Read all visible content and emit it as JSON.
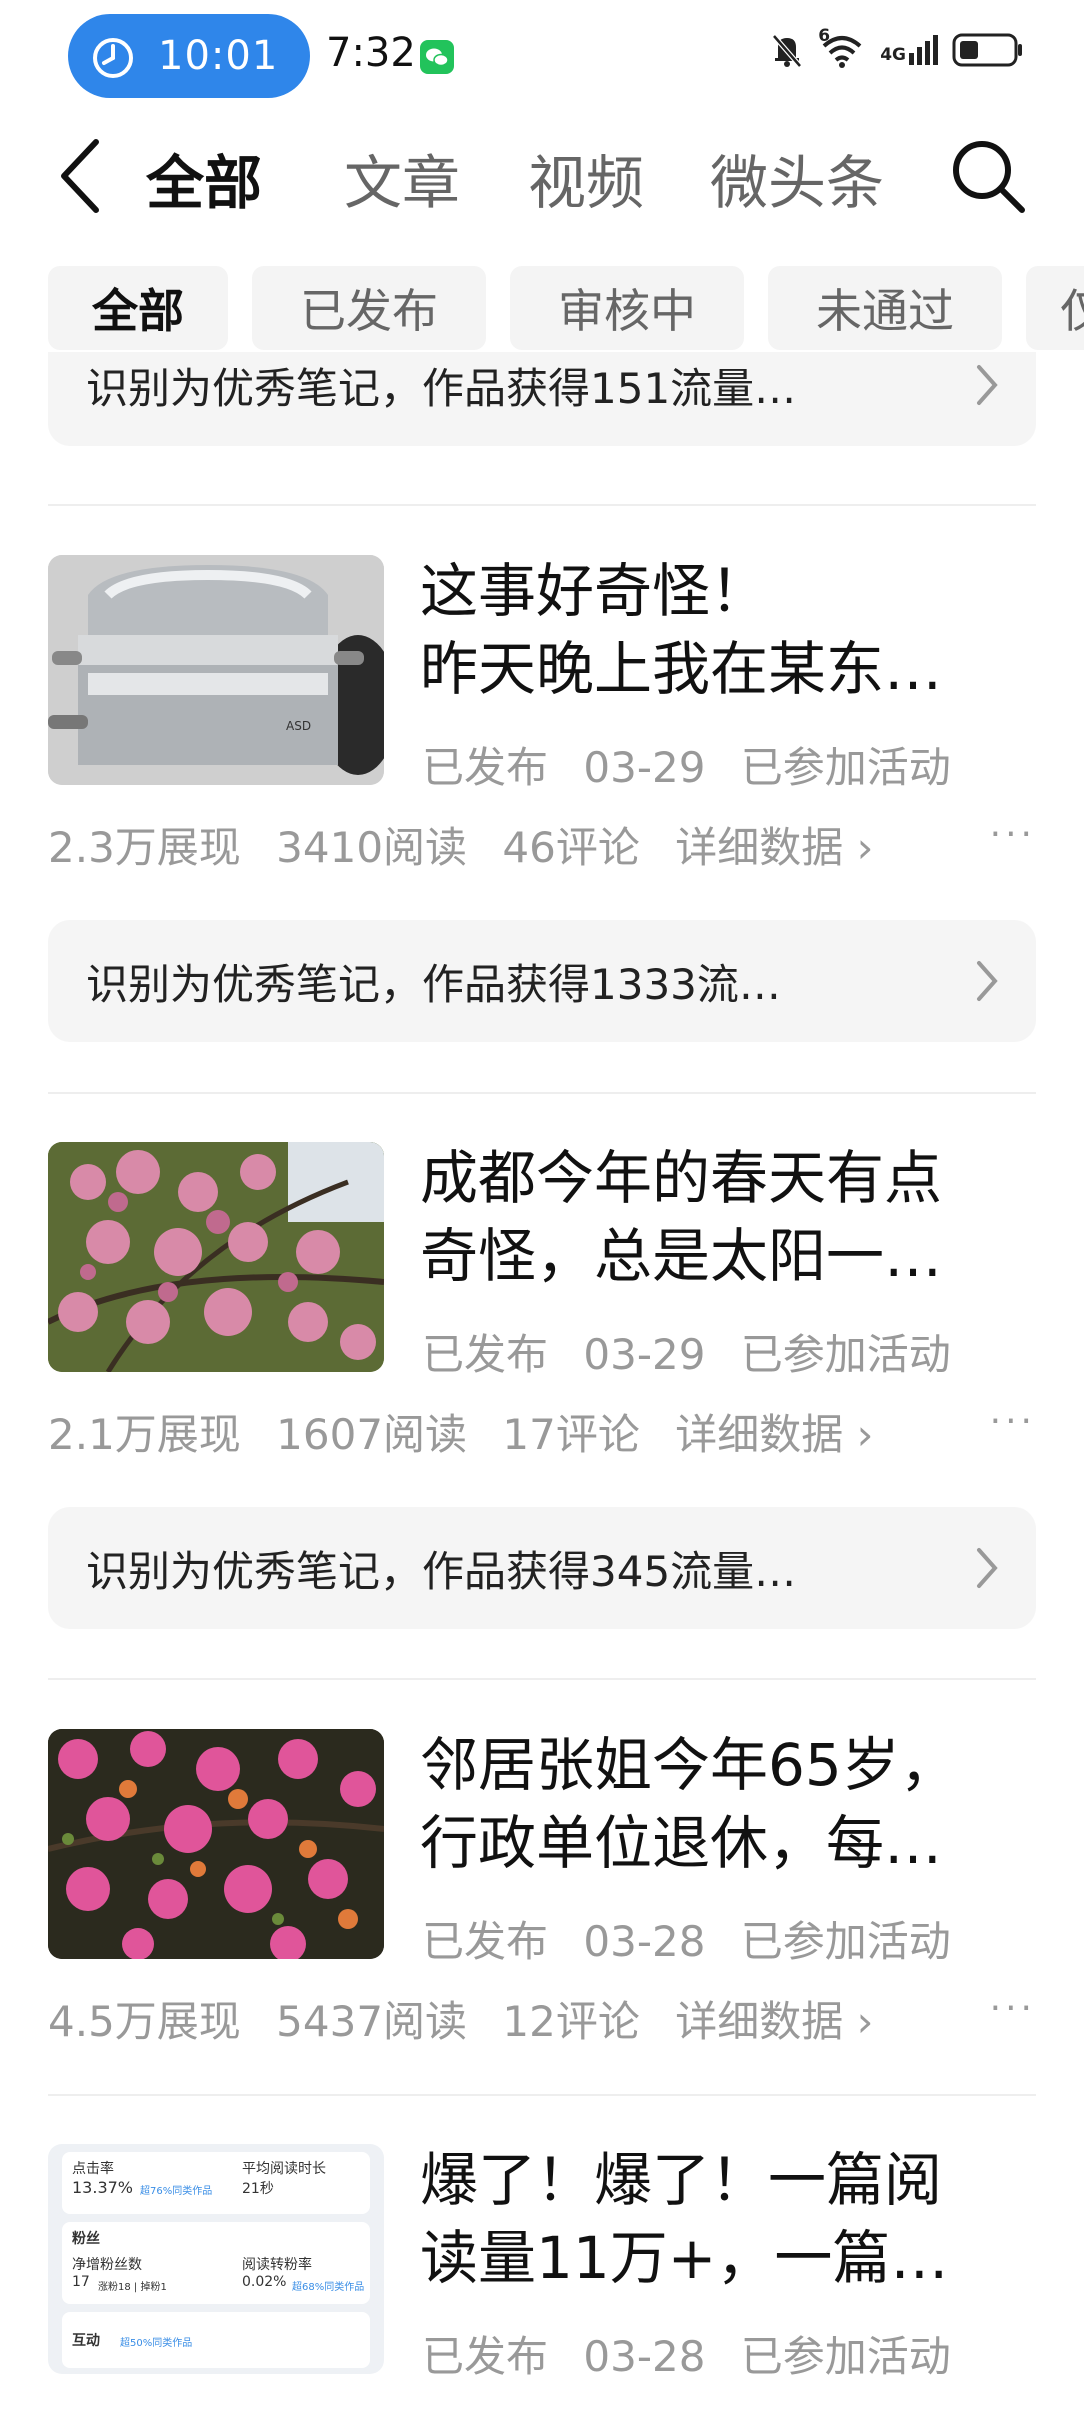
{
  "status_bar": {
    "timer": "10:01",
    "clock": "7:32",
    "signal_label": "6",
    "network": "4G",
    "icons": [
      "timer-icon",
      "wechat-icon",
      "mute-bell-icon",
      "wifi-icon",
      "signal-icon",
      "battery-icon"
    ]
  },
  "nav": {
    "tabs": [
      {
        "label": "全部",
        "active": true
      },
      {
        "label": "文章",
        "active": false
      },
      {
        "label": "视频",
        "active": false
      },
      {
        "label": "微头条",
        "active": false
      }
    ]
  },
  "filters": [
    {
      "label": "全部",
      "active": true
    },
    {
      "label": "已发布",
      "active": false
    },
    {
      "label": "审核中",
      "active": false
    },
    {
      "label": "未通过",
      "active": false
    },
    {
      "label": "仅",
      "active": false
    }
  ],
  "top_notice": "识别为优秀笔记，作品获得151流量…",
  "posts": [
    {
      "title_lines": [
        "这事好奇怪！",
        "昨天晚上我在某东…"
      ],
      "status": "已发布",
      "date": "03-29",
      "activity": "已参加活动",
      "impressions": "2.3万展现",
      "reads": "3410阅读",
      "comments": "46评论",
      "detail": "详细数据",
      "notice": "识别为优秀笔记，作品获得1333流…",
      "thumb": "steamer-pot"
    },
    {
      "title_lines": [
        "成都今年的春天有点",
        "奇怪，总是太阳一…"
      ],
      "status": "已发布",
      "date": "03-29",
      "activity": "已参加活动",
      "impressions": "2.1万展现",
      "reads": "1607阅读",
      "comments": "17评论",
      "detail": "详细数据",
      "notice": "识别为优秀笔记，作品获得345流量…",
      "thumb": "cherry-blossom"
    },
    {
      "title_lines": [
        "邻居张姐今年65岁，",
        "行政单位退休，每…"
      ],
      "status": "已发布",
      "date": "03-28",
      "activity": "已参加活动",
      "impressions": "4.5万展现",
      "reads": "5437阅读",
      "comments": "12评论",
      "detail": "详细数据",
      "thumb": "pink-blossom"
    },
    {
      "title_lines": [
        "爆了！爆了！一篇阅",
        "读量11万+，一篇…"
      ],
      "status": "已发布",
      "date": "03-28",
      "activity": "已参加活动",
      "thumb": "stats-screenshot",
      "thumb_text": {
        "click_rate_label": "点击率",
        "click_rate_value": "13.37%",
        "click_rate_badge": "超76%同类作品",
        "avg_time_label": "平均阅读时长",
        "avg_time_value": "21秒",
        "fans_label": "粉丝",
        "net_fans_label": "净增粉丝数",
        "net_fans_value": "17",
        "net_fans_detail": "涨粉18 | 掉粉1",
        "conversion_label": "阅读转粉率",
        "conversion_value": "0.02%",
        "conversion_badge": "超68%同类作品",
        "interaction_label": "互动",
        "interaction_badge": "超50%同类作品"
      }
    }
  ]
}
